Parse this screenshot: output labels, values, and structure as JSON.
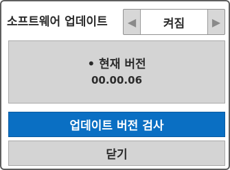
{
  "dialog": {
    "title": "소프트웨어 업데이트",
    "auto_update": {
      "value": "켜짐",
      "prev_arrow": "◀",
      "next_arrow": "▶"
    },
    "current_version": {
      "label": "• 현재 버전",
      "number": "00.00.06"
    },
    "buttons": {
      "check_update": "업데이트 버전 검사",
      "close": "닫기"
    }
  },
  "colors": {
    "primary_button": "#0a6fc3",
    "panel_gray": "#d4d4d4",
    "border": "#5e5e5e"
  },
  "icons": {
    "prev": "triangle-left-icon",
    "next": "triangle-right-icon"
  }
}
